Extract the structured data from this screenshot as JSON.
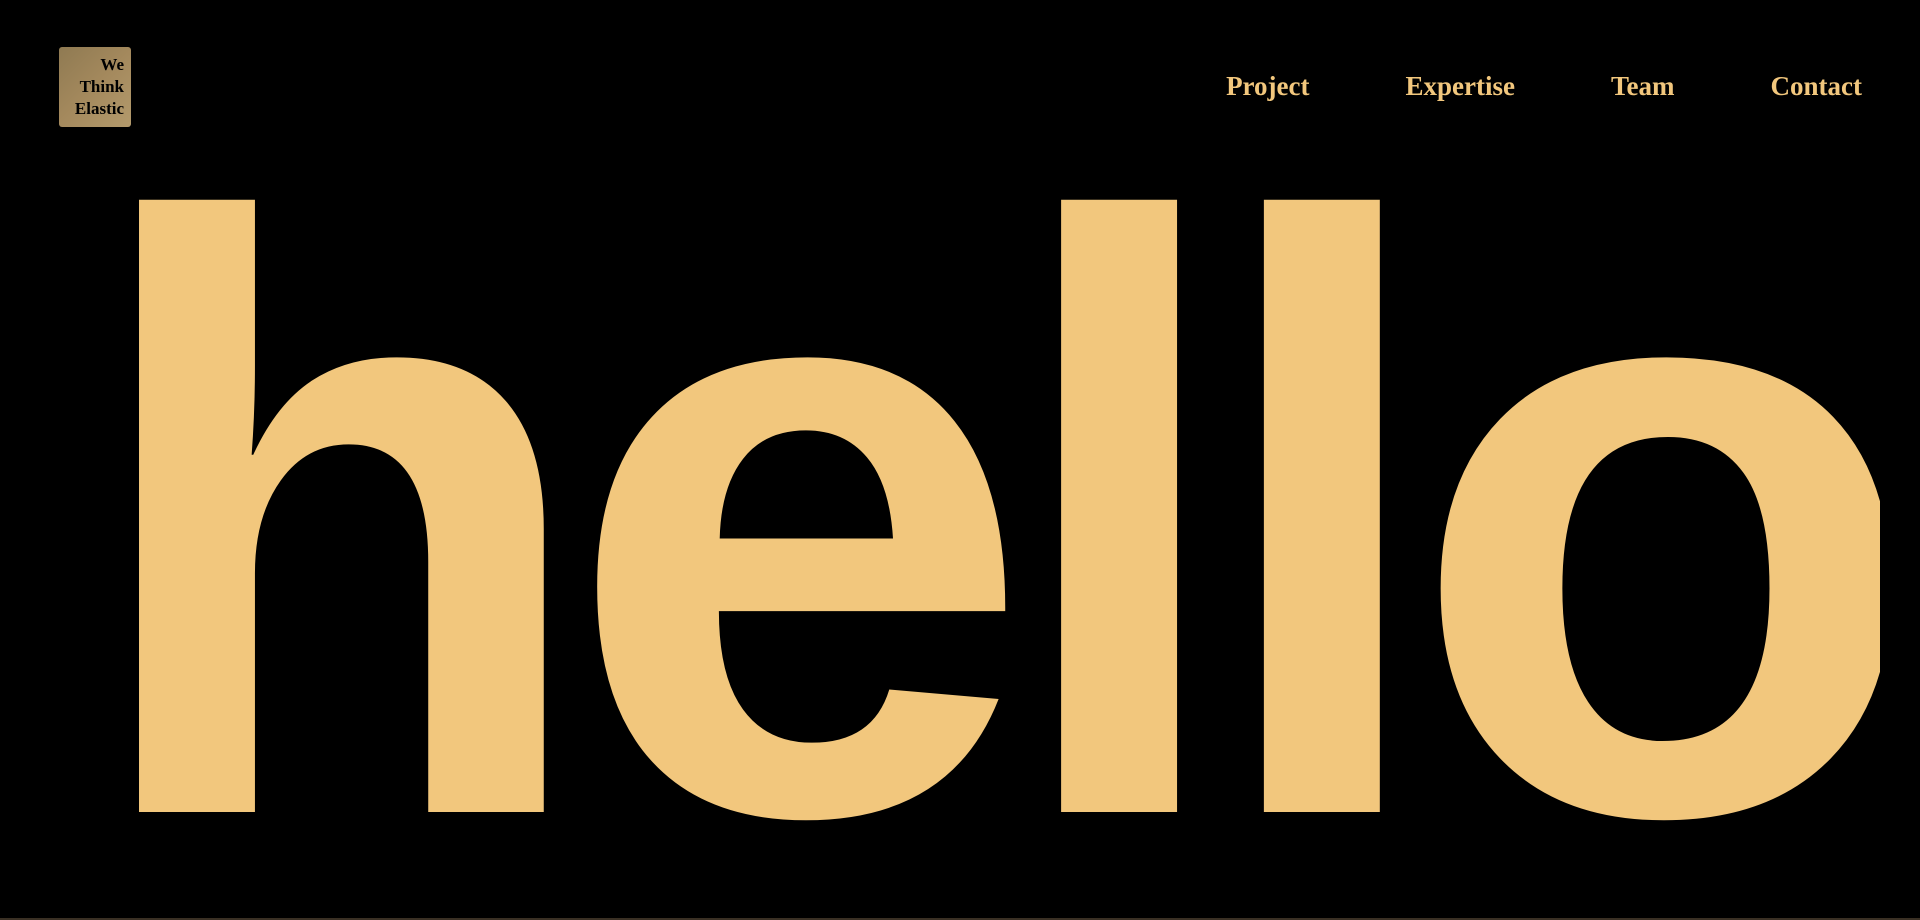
{
  "logo": {
    "line1": "We",
    "line2": "Think",
    "line3": "Elastic"
  },
  "nav": {
    "items": [
      {
        "label": "Project"
      },
      {
        "label": "Expertise"
      },
      {
        "label": "Team"
      },
      {
        "label": "Contact"
      }
    ]
  },
  "hero": {
    "text": "hello"
  },
  "colors": {
    "background": "#000000",
    "accent": "#f2c77d",
    "logo_background": "#a08a5e"
  }
}
